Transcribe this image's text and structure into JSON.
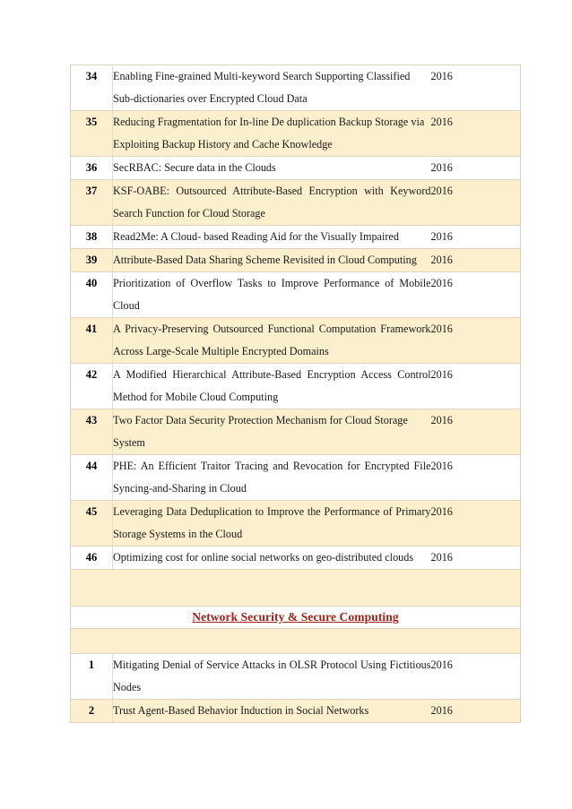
{
  "document": {
    "page_background": "#ffffff",
    "table": {
      "shaded_row_color": "#fcefce",
      "plain_row_color": "#ffffff",
      "border_color": "#d9cfbc"
    }
  },
  "section_header": {
    "label": "Network Security & Secure Computing",
    "color": "#a52019"
  },
  "rows": [
    {
      "num": "34",
      "title": "Enabling Fine-grained Multi-keyword Search Supporting Classified Sub-dictionaries over Encrypted Cloud Data",
      "year": "2016",
      "shaded": false,
      "justify": false
    },
    {
      "num": "35",
      "title": "Reducing Fragmentation for In-line De duplication Backup Storage via Exploiting Backup History and Cache Knowledge",
      "year": "2016",
      "shaded": true,
      "justify": false
    },
    {
      "num": "36",
      "title": "SecRBAC: Secure data in the Clouds",
      "year": "2016",
      "shaded": false,
      "justify": false
    },
    {
      "num": "37",
      "title": "KSF-OABE: Outsourced Attribute-Based Encryption with Keyword Search Function for Cloud Storage",
      "year": "2016",
      "shaded": true,
      "justify": true
    },
    {
      "num": "38",
      "title": "Read2Me: A Cloud- based Reading Aid for the Visually Impaired",
      "year": "2016",
      "shaded": false,
      "justify": false
    },
    {
      "num": "39",
      "title": "Attribute-Based Data Sharing Scheme Revisited in Cloud Computing",
      "year": "2016",
      "shaded": true,
      "justify": false
    },
    {
      "num": "40",
      "title": "Prioritization of Overflow Tasks to Improve Performance of Mobile Cloud",
      "year": "2016",
      "shaded": false,
      "justify": true
    },
    {
      "num": "41",
      "title": "A Privacy-Preserving Outsourced Functional Computation Framework Across Large-Scale Multiple Encrypted Domains",
      "year": "2016",
      "shaded": true,
      "justify": true
    },
    {
      "num": "42",
      "title": "A Modified Hierarchical Attribute-Based Encryption Access Control Method for Mobile Cloud Computing",
      "year": "2016",
      "shaded": false,
      "justify": true
    },
    {
      "num": "43",
      "title": "Two Factor Data Security Protection Mechanism for Cloud Storage System",
      "year": "2016",
      "shaded": true,
      "justify": false
    },
    {
      "num": "44",
      "title": "PHE: An Efficient Traitor Tracing and Revocation for Encrypted File Syncing-and-Sharing in Cloud",
      "year": "2016",
      "shaded": false,
      "justify": true
    },
    {
      "num": "45",
      "title": "Leveraging Data Deduplication to Improve the Performance of Primary Storage Systems in the Cloud",
      "year": "2016",
      "shaded": true,
      "justify": true
    },
    {
      "num": "46",
      "title": "Optimizing cost for online social networks on geo-distributed clouds",
      "year": "2016",
      "shaded": false,
      "justify": true
    }
  ],
  "rows_after_header": [
    {
      "num": "1",
      "title": "Mitigating Denial of Service Attacks in OLSR Protocol Using Fictitious Nodes",
      "year": "2016",
      "shaded": false,
      "justify": true
    },
    {
      "num": "2",
      "title": "Trust Agent-Based Behavior Induction in Social Networks",
      "year": "2016",
      "shaded": true,
      "justify": false
    }
  ]
}
